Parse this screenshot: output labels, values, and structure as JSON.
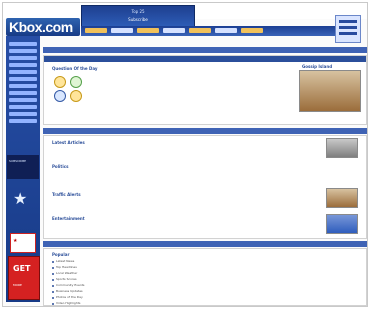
{
  "header": {
    "logo_text": "Kbox.com",
    "banner": {
      "line1": "Top 25",
      "line2": "Subscribe"
    }
  },
  "content": {
    "featured": {
      "left_label": "Question Of the Day",
      "mid_text": "",
      "right_label": "Gossip Island"
    },
    "stories": [
      {
        "title": "Latest Articles"
      },
      {
        "title": "Politics"
      },
      {
        "title": "Traffic Alerts"
      },
      {
        "title": "Entertainment"
      }
    ],
    "lower": {
      "section_title": "Popular",
      "items": [
        {
          "text": "Latest News"
        },
        {
          "text": "Top Headlines"
        },
        {
          "text": "Local Weather"
        },
        {
          "text": "Sports Scores"
        },
        {
          "text": "Community Events"
        },
        {
          "text": "Business Updates"
        },
        {
          "text": "Photos of the Day"
        },
        {
          "text": "Video Highlights"
        }
      ]
    }
  },
  "sidebar": {
    "promo_text": "SUBSCRIBE",
    "cta": {
      "title": "GET",
      "subtitle": "MORE"
    }
  }
}
